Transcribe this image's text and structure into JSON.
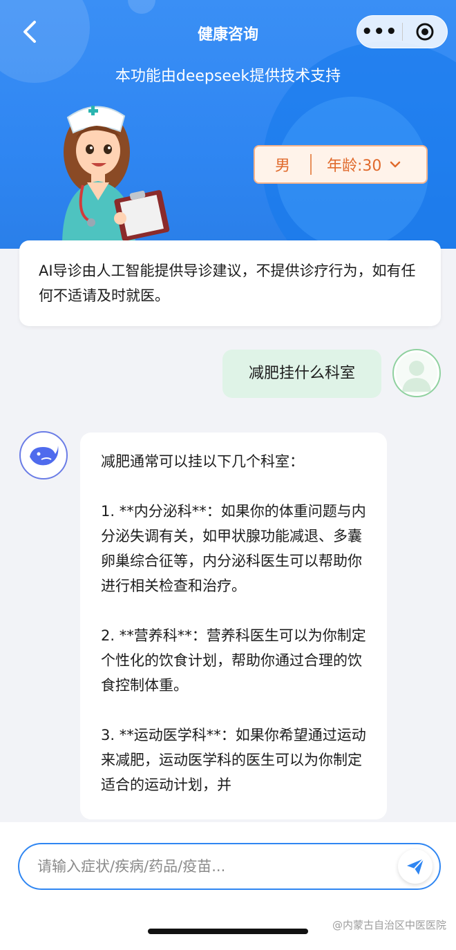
{
  "header": {
    "title": "健康咨询",
    "subtitle": "本功能由deepseek提供技术支持",
    "back_icon": "chevron-left-icon",
    "more_label": "•••",
    "close_icon": "target-circle-icon"
  },
  "profile": {
    "gender": "男",
    "age_label": "年龄:30",
    "dropdown_icon": "chevron-down-icon"
  },
  "notice": {
    "text": "AI导诊由人工智能提供导诊建议，不提供诊疗行为，如有任何不适请及时就医。"
  },
  "messages": {
    "user": {
      "text": "减肥挂什么科室"
    },
    "bot": {
      "lines": [
        "减肥通常可以挂以下几个科室：",
        "1. **内分泌科**：如果你的体重问题与内分泌失调有关，如甲状腺功能减退、多囊卵巢综合征等，内分泌科医生可以帮助你进行相关检查和治疗。",
        "2. **营养科**：营养科医生可以为你制定个性化的饮食计划，帮助你通过合理的饮食控制体重。",
        "3. **运动医学科**：如果你希望通过运动来减肥，运动医学科的医生可以为你制定适合的运动计划，并"
      ]
    }
  },
  "input": {
    "placeholder": "请输入症状/疾病/药品/疫苗...",
    "send_icon": "paper-plane-icon"
  },
  "watermark": "@内蒙古自治区中医医院",
  "colors": {
    "header_blue": "#2f86f2",
    "profile_orange": "#e06a2c",
    "user_bubble": "#dff3e7",
    "bot_avatar_border": "#6a7ce6"
  }
}
